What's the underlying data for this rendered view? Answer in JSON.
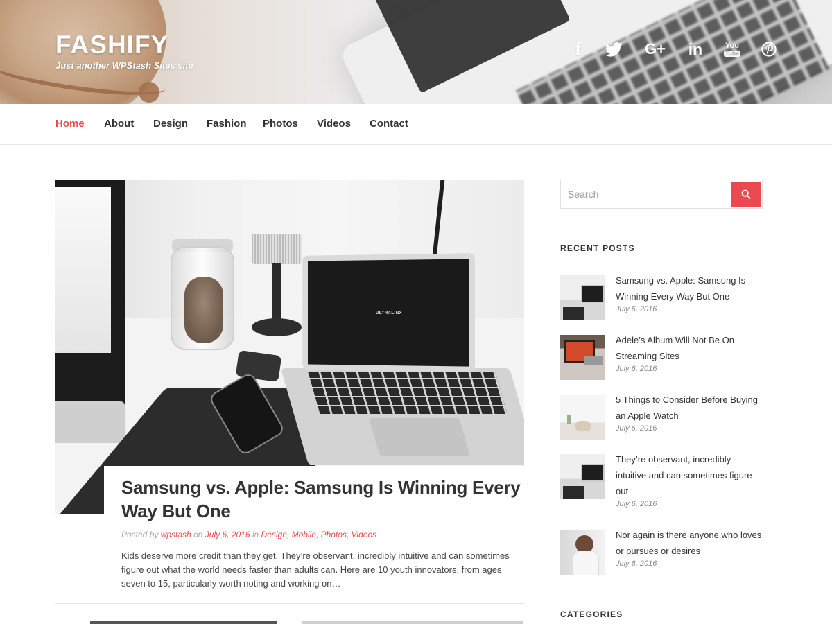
{
  "header": {
    "site_title": "FASHIFY",
    "tagline": "Just another WPStash Sites site",
    "social_icons": [
      "facebook-icon",
      "twitter-icon",
      "google-plus-icon",
      "linkedin-icon",
      "youtube-icon",
      "pinterest-icon"
    ],
    "social_glyphs": {
      "facebook": "f",
      "googleplus": "G+",
      "linkedin": "in",
      "youtube_top": "You",
      "youtube_bottom": "Tube"
    }
  },
  "nav": {
    "items": [
      {
        "label": "Home",
        "active": true
      },
      {
        "label": "About",
        "active": false
      },
      {
        "label": "Design",
        "active": false
      },
      {
        "label": "Fashion",
        "active": false
      },
      {
        "label": "Photos",
        "active": false
      },
      {
        "label": "Videos",
        "active": false
      },
      {
        "label": "Contact",
        "active": false
      }
    ],
    "active_color": "#ea4a4f"
  },
  "featured_post": {
    "image_label": "ULTRALINX",
    "title": "Samsung vs. Apple: Samsung Is Winning Every Way But One",
    "meta": {
      "posted_by_label": "Posted by",
      "author": "wpstash",
      "on_label": "on",
      "date": "July 6, 2016",
      "in_label": "in",
      "categories": [
        "Design",
        "Mobile",
        "Photos",
        "Videos"
      ]
    },
    "excerpt": "Kids deserve more credit than they get. They’re observant, incredibly intuitive and can sometimes figure out what the world needs faster than adults can. Here are 10 youth innovators, from ages seven to 15, particularly worth noting and working on…"
  },
  "sidebar": {
    "search": {
      "placeholder": "Search",
      "button_icon": "search-icon"
    },
    "recent_posts": {
      "title": "RECENT POSTS",
      "items": [
        {
          "title": "Samsung vs. Apple: Samsung Is Winning Every Way But One",
          "date": "July 6, 2016"
        },
        {
          "title": "Adele’s Album Will Not Be On Streaming Sites",
          "date": "July 6, 2016"
        },
        {
          "title": "5 Things to Consider Before Buying an Apple Watch",
          "date": "July 6, 2016"
        },
        {
          "title": "They’re observant, incredibly intuitive and can sometimes figure out",
          "date": "July 6, 2016"
        },
        {
          "title": "Nor again is there anyone who loves or pursues or desires",
          "date": "July 6, 2016"
        }
      ]
    },
    "categories": {
      "title": "CATEGORIES"
    }
  },
  "colors": {
    "accent": "#ea4a4f",
    "text": "#333333",
    "muted": "#aaaaaa"
  }
}
